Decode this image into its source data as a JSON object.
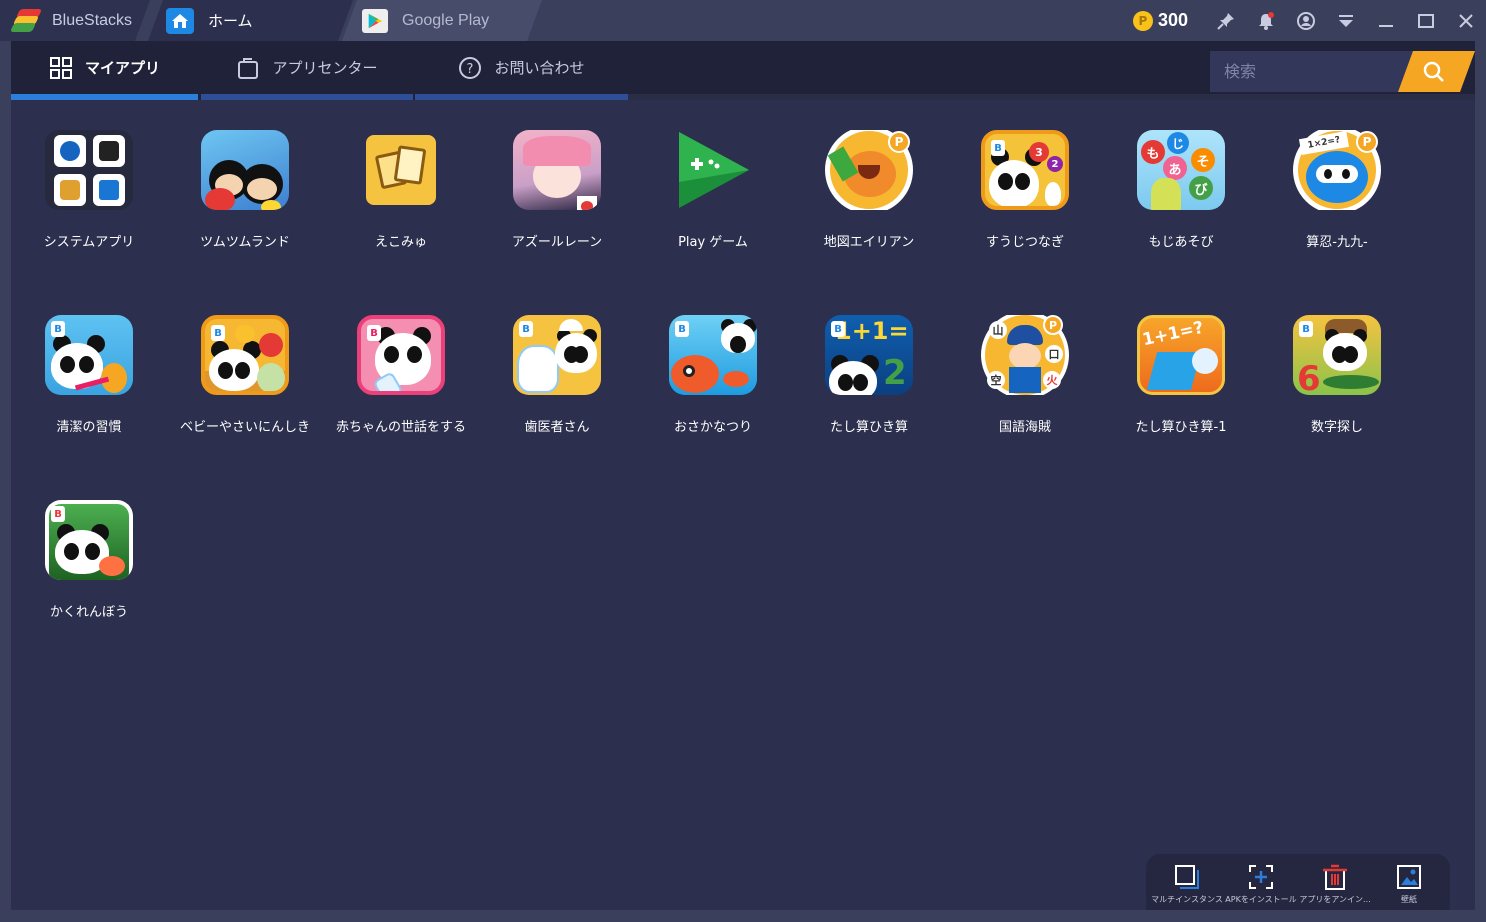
{
  "titlebar": {
    "brand": "BlueStacks",
    "tabs": [
      {
        "label": "ホーム"
      },
      {
        "label": "Google Play"
      }
    ],
    "coins": "300",
    "coin_symbol": "P",
    "icons": [
      "pin-icon",
      "bell-icon",
      "account-icon",
      "dropdown-icon",
      "minimize-icon",
      "maximize-icon",
      "close-icon"
    ],
    "notification_color": "#e53935"
  },
  "nav": {
    "tabs": [
      {
        "label": "マイアプリ",
        "icon": "grid-icon",
        "active": true
      },
      {
        "label": "アプリセンター",
        "icon": "bag-icon",
        "active": false
      },
      {
        "label": "お問い合わせ",
        "icon": "help-icon",
        "active": false
      }
    ],
    "search_placeholder": "検索",
    "accent_color": "#2b7ed9",
    "search_button_color": "#f5a623"
  },
  "apps": [
    {
      "label": "システムアプリ"
    },
    {
      "label": "ツムツムランド"
    },
    {
      "label": "えこみゅ"
    },
    {
      "label": "アズールレーン"
    },
    {
      "label": "Play ゲーム"
    },
    {
      "label": "地図エイリアン"
    },
    {
      "label": "すうじつなぎ"
    },
    {
      "label": "もじあそび"
    },
    {
      "label": "算忍-九九-"
    },
    {
      "label": "清潔の習慣"
    },
    {
      "label": "ベビーやさいにんしき"
    },
    {
      "label": "赤ちゃんの世話をする"
    },
    {
      "label": "歯医者さん"
    },
    {
      "label": "おさかなつり"
    },
    {
      "label": "たし算ひき算"
    },
    {
      "label": "国語海賊"
    },
    {
      "label": "たし算ひき算-1"
    },
    {
      "label": "数字探し"
    },
    {
      "label": "かくれんぼう"
    }
  ],
  "icon_text": {
    "maze_numbers": [
      "0",
      "1",
      "2",
      "3"
    ],
    "moji_chars": [
      "も",
      "じ",
      "あ",
      "そ",
      "び"
    ],
    "sannin_text": "1×2=?",
    "tashizan_text": "1+1=",
    "tashizan_answer": "2",
    "kokugo_chars": [
      "山",
      "口",
      "空",
      "火"
    ],
    "tashizan1_text": "1+1=?",
    "suji_digit": "6",
    "p_badge": "P",
    "b_badge": "B"
  },
  "toolbar": {
    "items": [
      {
        "label": "マルチインスタンス",
        "icon": "multi-instance-icon"
      },
      {
        "label": "APKをインストール",
        "icon": "install-apk-icon"
      },
      {
        "label": "アプリをアンイン...",
        "icon": "uninstall-icon"
      },
      {
        "label": "壁紙",
        "icon": "wallpaper-icon"
      }
    ]
  }
}
